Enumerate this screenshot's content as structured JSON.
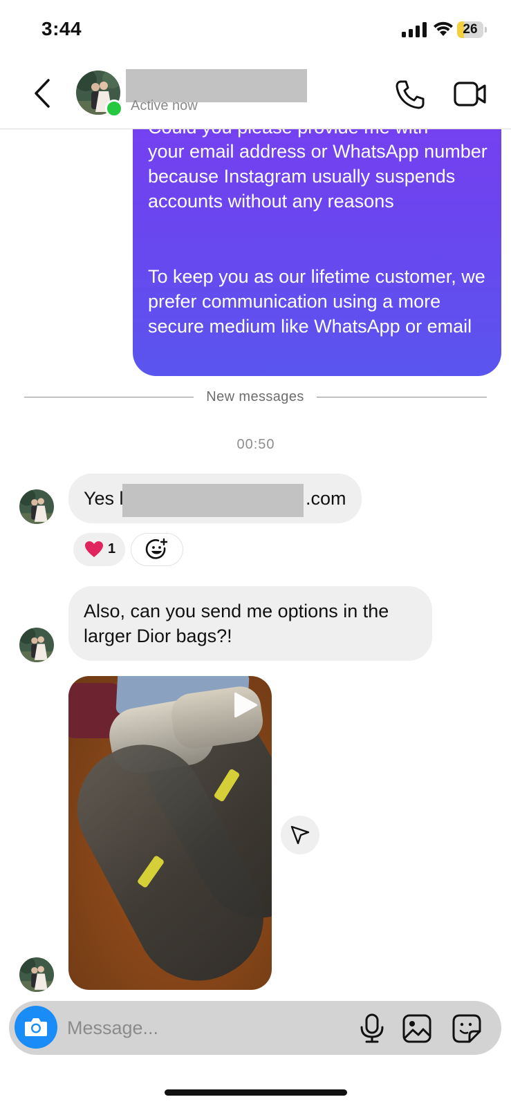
{
  "status_bar": {
    "time": "3:44",
    "battery_percent": "26",
    "battery_level": 0.26
  },
  "header": {
    "active_status": "Active now",
    "back_icon": "chevron-left-icon",
    "call_icon": "phone-icon",
    "video_icon": "video-camera-icon"
  },
  "outgoing_message": {
    "partial_line": "Could you please provide me with",
    "paragraph_1": "your email address or WhatsApp number because Instagram usually suspends accounts without any reasons",
    "paragraph_2": "To keep you as our lifetime customer, we prefer communication using a more secure medium like WhatsApp or email",
    "bubble_gradient": [
      "#7a3ff0",
      "#5a55ee"
    ]
  },
  "divider": {
    "label": "New messages"
  },
  "timestamp": "00:50",
  "incoming_messages": [
    {
      "prefix": "Yes l",
      "suffix": ".com",
      "reactions": [
        {
          "emoji": "heart",
          "count": "1"
        }
      ]
    },
    {
      "text": "Also, can you send me options in the larger Dior bags?!"
    }
  ],
  "video_message": {
    "play_icon": "play-icon",
    "share_icon": "send-icon"
  },
  "composer": {
    "placeholder": "Message...",
    "camera_icon": "camera-icon",
    "mic_icon": "microphone-icon",
    "gallery_icon": "image-icon",
    "sticker_icon": "sticker-icon"
  },
  "colors": {
    "accent_blue": "#1a8cf7",
    "online_green": "#26c840",
    "incoming_bubble": "#efefef",
    "heart": "#e0245e"
  }
}
